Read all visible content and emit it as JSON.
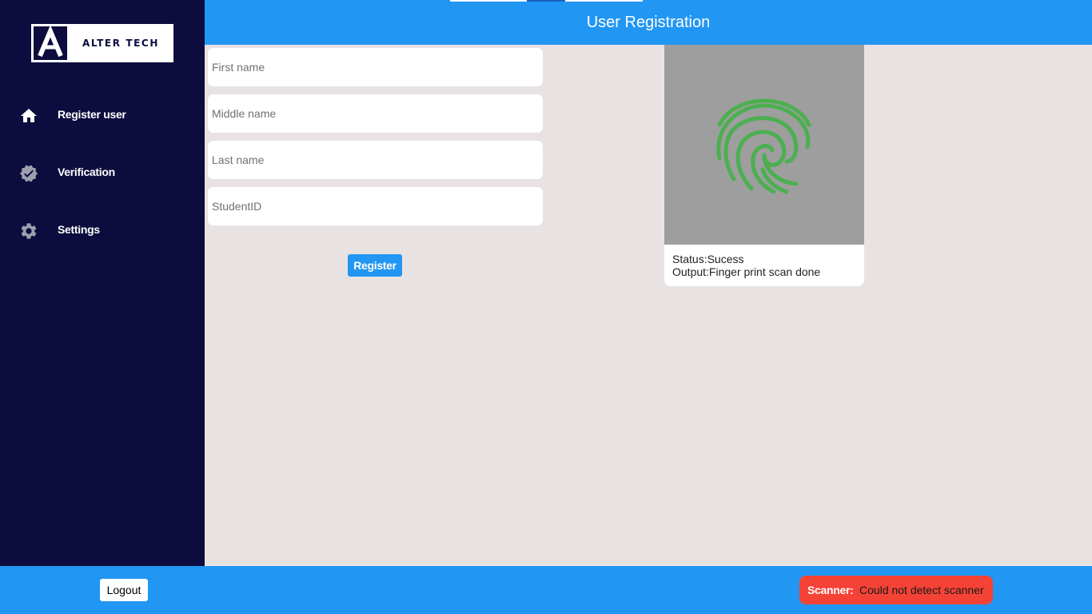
{
  "brand": {
    "logo_letter": "A",
    "name": "ALTER TECH"
  },
  "sidebar": {
    "items": [
      {
        "label": "Register user",
        "icon": "home-icon"
      },
      {
        "label": "Verification",
        "icon": "verified-badge-icon"
      },
      {
        "label": "Settings",
        "icon": "gear-icon"
      }
    ]
  },
  "header": {
    "title": "User Registration"
  },
  "form": {
    "first_name_placeholder": "First name",
    "middle_name_placeholder": "Middle name",
    "last_name_placeholder": "Last name",
    "student_id_placeholder": "StudentID",
    "register_label": "Register"
  },
  "scanner_panel": {
    "icon": "fingerprint-icon",
    "status": "Status:Sucess",
    "output": "Output:Finger print scan done"
  },
  "footer": {
    "logout_label": "Logout",
    "scanner_label": "Scanner:",
    "scanner_message": "Could not detect scanner"
  },
  "colors": {
    "sidebar_bg": "#0c0c3e",
    "primary": "#2196f3",
    "content_bg": "#e9e2e3",
    "fingerprint": "#4caf50",
    "error": "#f44336"
  }
}
